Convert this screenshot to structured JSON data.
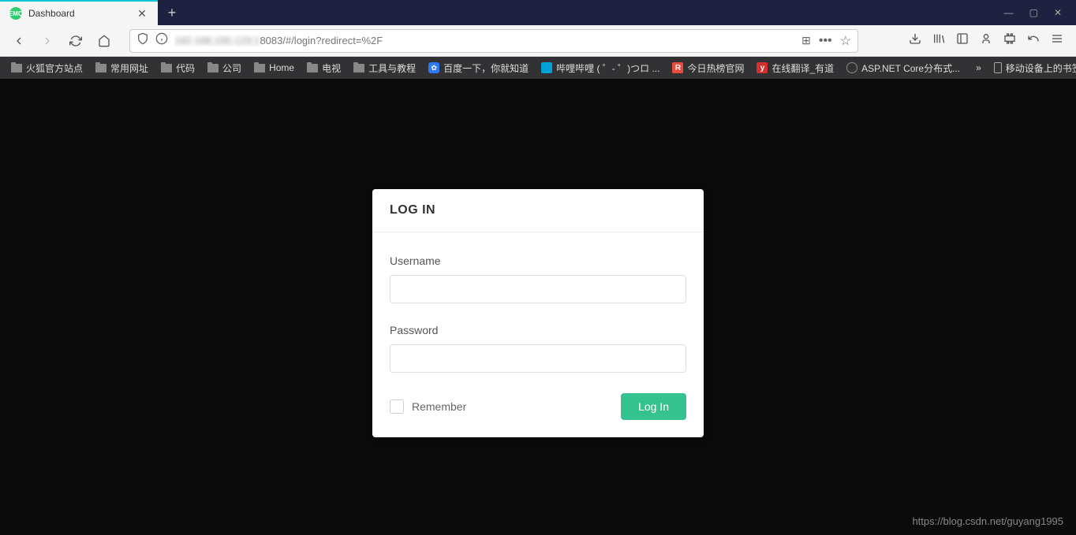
{
  "browser": {
    "tab": {
      "title": "Dashboard",
      "favicon_text": "EMQ"
    },
    "url_visible_suffix": "8083/#/login?redirect=%2F"
  },
  "bookmarks": {
    "items": [
      {
        "label": "火狐官方站点",
        "icon": "folder"
      },
      {
        "label": "常用网址",
        "icon": "folder"
      },
      {
        "label": "代码",
        "icon": "folder"
      },
      {
        "label": "公司",
        "icon": "folder"
      },
      {
        "label": "Home",
        "icon": "folder"
      },
      {
        "label": "电视",
        "icon": "folder"
      },
      {
        "label": "工具与教程",
        "icon": "folder"
      },
      {
        "label": "百度一下，你就知道",
        "icon": "baidu"
      },
      {
        "label": "哔哩哔哩 ( ゜- ゜)つロ ...",
        "icon": "bili"
      },
      {
        "label": "今日热榜官网",
        "icon": "rebang"
      },
      {
        "label": "在线翻译_有道",
        "icon": "youdao"
      },
      {
        "label": "ASP.NET Core分布式...",
        "icon": "generic"
      }
    ],
    "right_item": {
      "label": "移动设备上的书签",
      "icon": "mobile"
    }
  },
  "login": {
    "title": "LOG IN",
    "username_label": "Username",
    "username_value": "",
    "password_label": "Password",
    "password_value": "",
    "remember_label": "Remember",
    "submit_label": "Log In"
  },
  "watermark": "https://blog.csdn.net/guyang1995"
}
